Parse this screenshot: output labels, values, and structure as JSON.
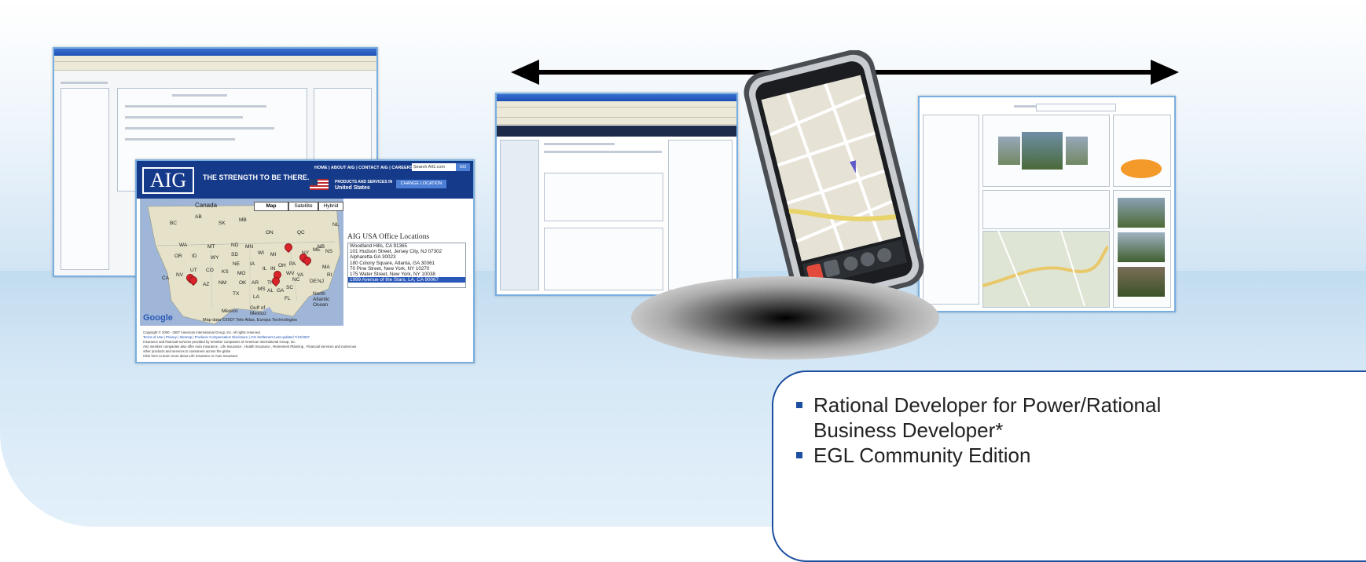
{
  "aig_site": {
    "logo": "AIG",
    "tagline": "THE STRENGTH TO BE THERE.",
    "nav": [
      "HOME",
      "ABOUT AIG",
      "CONTACT AIG",
      "CAREERS"
    ],
    "search_placeholder": "Search AIG.com",
    "go_label": "GO",
    "products_label": "PRODUCTS AND SERVICES IN",
    "country": "United States",
    "change_location": "CHANGE LOCATION",
    "map_types": [
      "Map",
      "Satellite",
      "Hybrid"
    ],
    "map_labels": [
      "Canada",
      "AB",
      "SK",
      "MB",
      "BC",
      "ON",
      "QC",
      "NL",
      "WA",
      "MT",
      "ND",
      "MN",
      "WI",
      "MI",
      "NB",
      "NS",
      "OR",
      "ID",
      "WY",
      "SD",
      "NE",
      "IA",
      "IL",
      "IN",
      "OH",
      "PA",
      "NY",
      "ME",
      "NV",
      "UT",
      "CO",
      "KS",
      "MO",
      "KY",
      "WV",
      "VA",
      "MA",
      "CA",
      "AZ",
      "NM",
      "OK",
      "AR",
      "TN",
      "NC",
      "DE",
      "NJ",
      "RI",
      "TX",
      "MS",
      "AL",
      "GA",
      "SC",
      "LA",
      "FL",
      "Mexico",
      "Gulf of Mexico",
      "North Atlantic Ocean"
    ],
    "map_credit": "Map data ©2007 Tele Atlas, Europa Technologies",
    "google_label": "Google",
    "offices_title": "AIG USA Office Locations",
    "offices": [
      "Woodland Hills, CA 91365",
      "101 Hudson Street, Jersey City, NJ 07302",
      "Alpharetta GA 30023",
      "180 Colony Square, Atlanta, GA 30361",
      "70 Pine Street, New York, NY 10270",
      "175 Water Street, New York, NY 10038",
      "1999 Avenue of the Stars, LA, CA 90067"
    ],
    "footer": [
      "Copyright © 2000 - 2007 American International Group, Inc. All rights reserved.",
      "Terms of Use | Privacy | Sitemap | Producer Compensation Disclosure | AIG Settlement  Last updated 7/10/2007",
      "Insurance and financial services provided by member companies of American International Group, Inc.",
      "AIG member companies also offer Auto Insurance , Life Insurance , Health Insurance , Retirement Planning , Financial Services  and numerous",
      "other products and services to customers across the globe.",
      "Click here to learn more about Life Insurance  or Auto Insurance"
    ]
  },
  "colors": {
    "aig_blue": "#153a8a",
    "frame_border": "#79aee0",
    "callout_border": "#1c4fa0",
    "pin_red": "#d8242a"
  },
  "callout": {
    "items": [
      "Rational Developer for Power/Rational Business Developer*",
      "EGL Community Edition"
    ]
  },
  "icons": [
    "double-arrow-icon",
    "mail-icon",
    "phone-icon",
    "map-pin-icon"
  ]
}
